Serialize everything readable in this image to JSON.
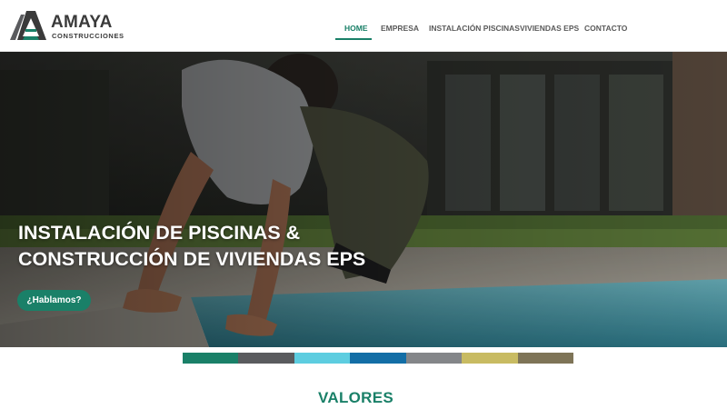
{
  "brand": {
    "name": "AMAYA",
    "subtitle": "CONSTRUCCIONES",
    "accent_color": "#1a8068"
  },
  "nav": {
    "items": [
      {
        "label": "HOME",
        "active": true
      },
      {
        "label": "EMPRESA",
        "active": false
      },
      {
        "label": "INSTALACIÓN PISCINAS",
        "active": false
      },
      {
        "label": "VIVIENDAS EPS",
        "active": false
      },
      {
        "label": "CONTACTO",
        "active": false
      }
    ]
  },
  "hero": {
    "title_line1": "INSTALACIÓN DE PISCINAS &",
    "title_line2": "CONSTRUCCIÓN DE VIVIENDAS EPS",
    "cta_label": "¿Hablamos?"
  },
  "color_strip": [
    "#1a8068",
    "#5a5b5e",
    "#5dcde0",
    "#136ea6",
    "#848689",
    "#c8bb62",
    "#7e7457"
  ],
  "section": {
    "title": "VALORES"
  }
}
